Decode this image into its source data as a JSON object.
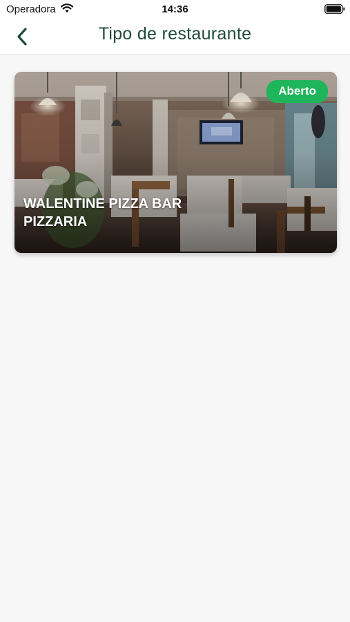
{
  "status_bar": {
    "carrier": "Operadora",
    "time": "14:36",
    "wifi_icon": "wifi-icon",
    "battery_icon": "battery-full-icon"
  },
  "nav": {
    "back_icon": "chevron-left-icon",
    "title": "Tipo de restaurante"
  },
  "restaurants": [
    {
      "name": "WALENTINE PIZZA BAR PIZZARIA",
      "status": "Aberto",
      "status_color": "#1fb55a"
    }
  ],
  "colors": {
    "title": "#1f4a3a",
    "background": "#f7f7f7",
    "badge_open": "#1fb55a"
  }
}
